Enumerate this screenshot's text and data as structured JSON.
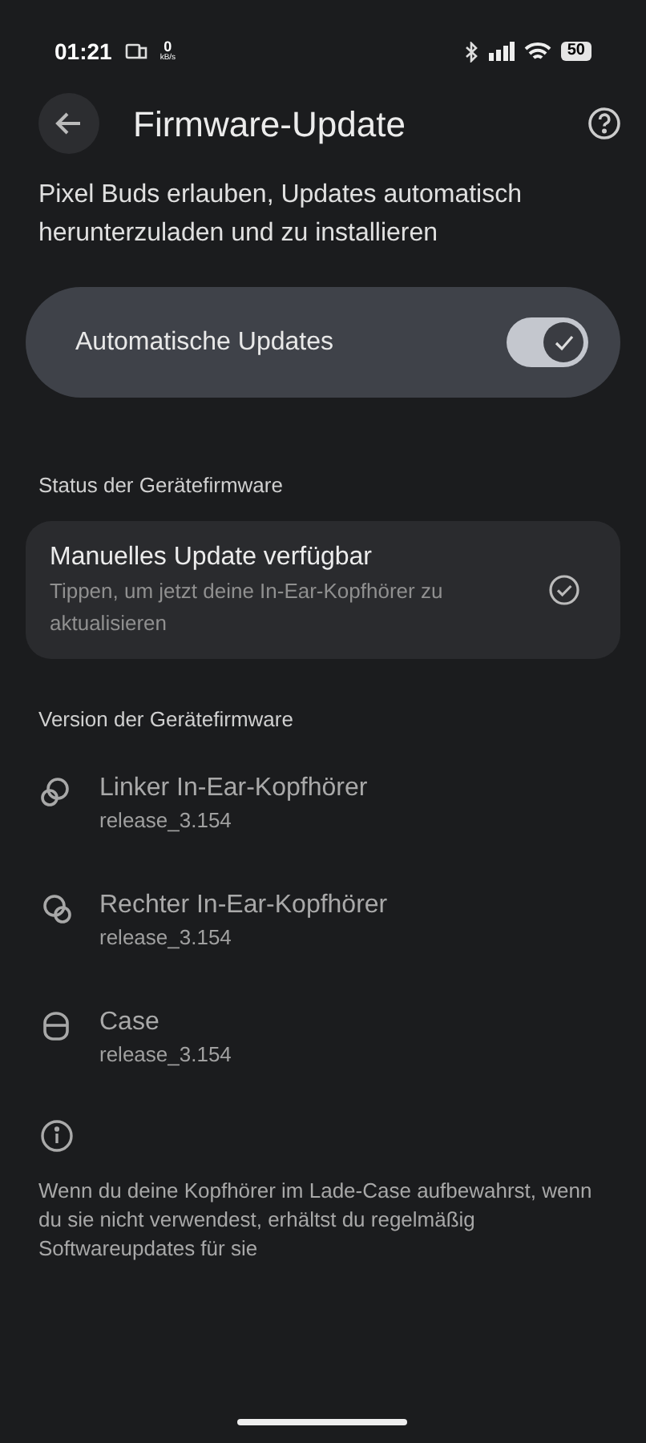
{
  "status_bar": {
    "time": "01:21",
    "net_speed": "0",
    "net_unit": "kB/s",
    "battery": "50"
  },
  "header": {
    "title": "Firmware-Update"
  },
  "description": "Pixel Buds erlauben, Updates automatisch herunterzuladen und zu installieren",
  "auto_updates": {
    "label": "Automatische Updates",
    "on": true
  },
  "status_section": {
    "heading": "Status der Gerätefirmware",
    "title": "Manuelles Update verfügbar",
    "subtitle": "Tippen, um jetzt deine In-Ear-Kopfhörer zu aktualisieren"
  },
  "version_section": {
    "heading": "Version der Gerätefirmware",
    "devices": [
      {
        "kind": "left",
        "name": "Linker In-Ear-Kopfhörer",
        "version": "release_3.154"
      },
      {
        "kind": "right",
        "name": "Rechter In-Ear-Kopfhörer",
        "version": "release_3.154"
      },
      {
        "kind": "case",
        "name": "Case",
        "version": "release_3.154"
      }
    ]
  },
  "footnote": "Wenn du deine Kopfhörer im Lade-Case aufbewahrst, wenn du sie nicht verwendest, erhältst du regelmäßig Softwareupdates für sie"
}
